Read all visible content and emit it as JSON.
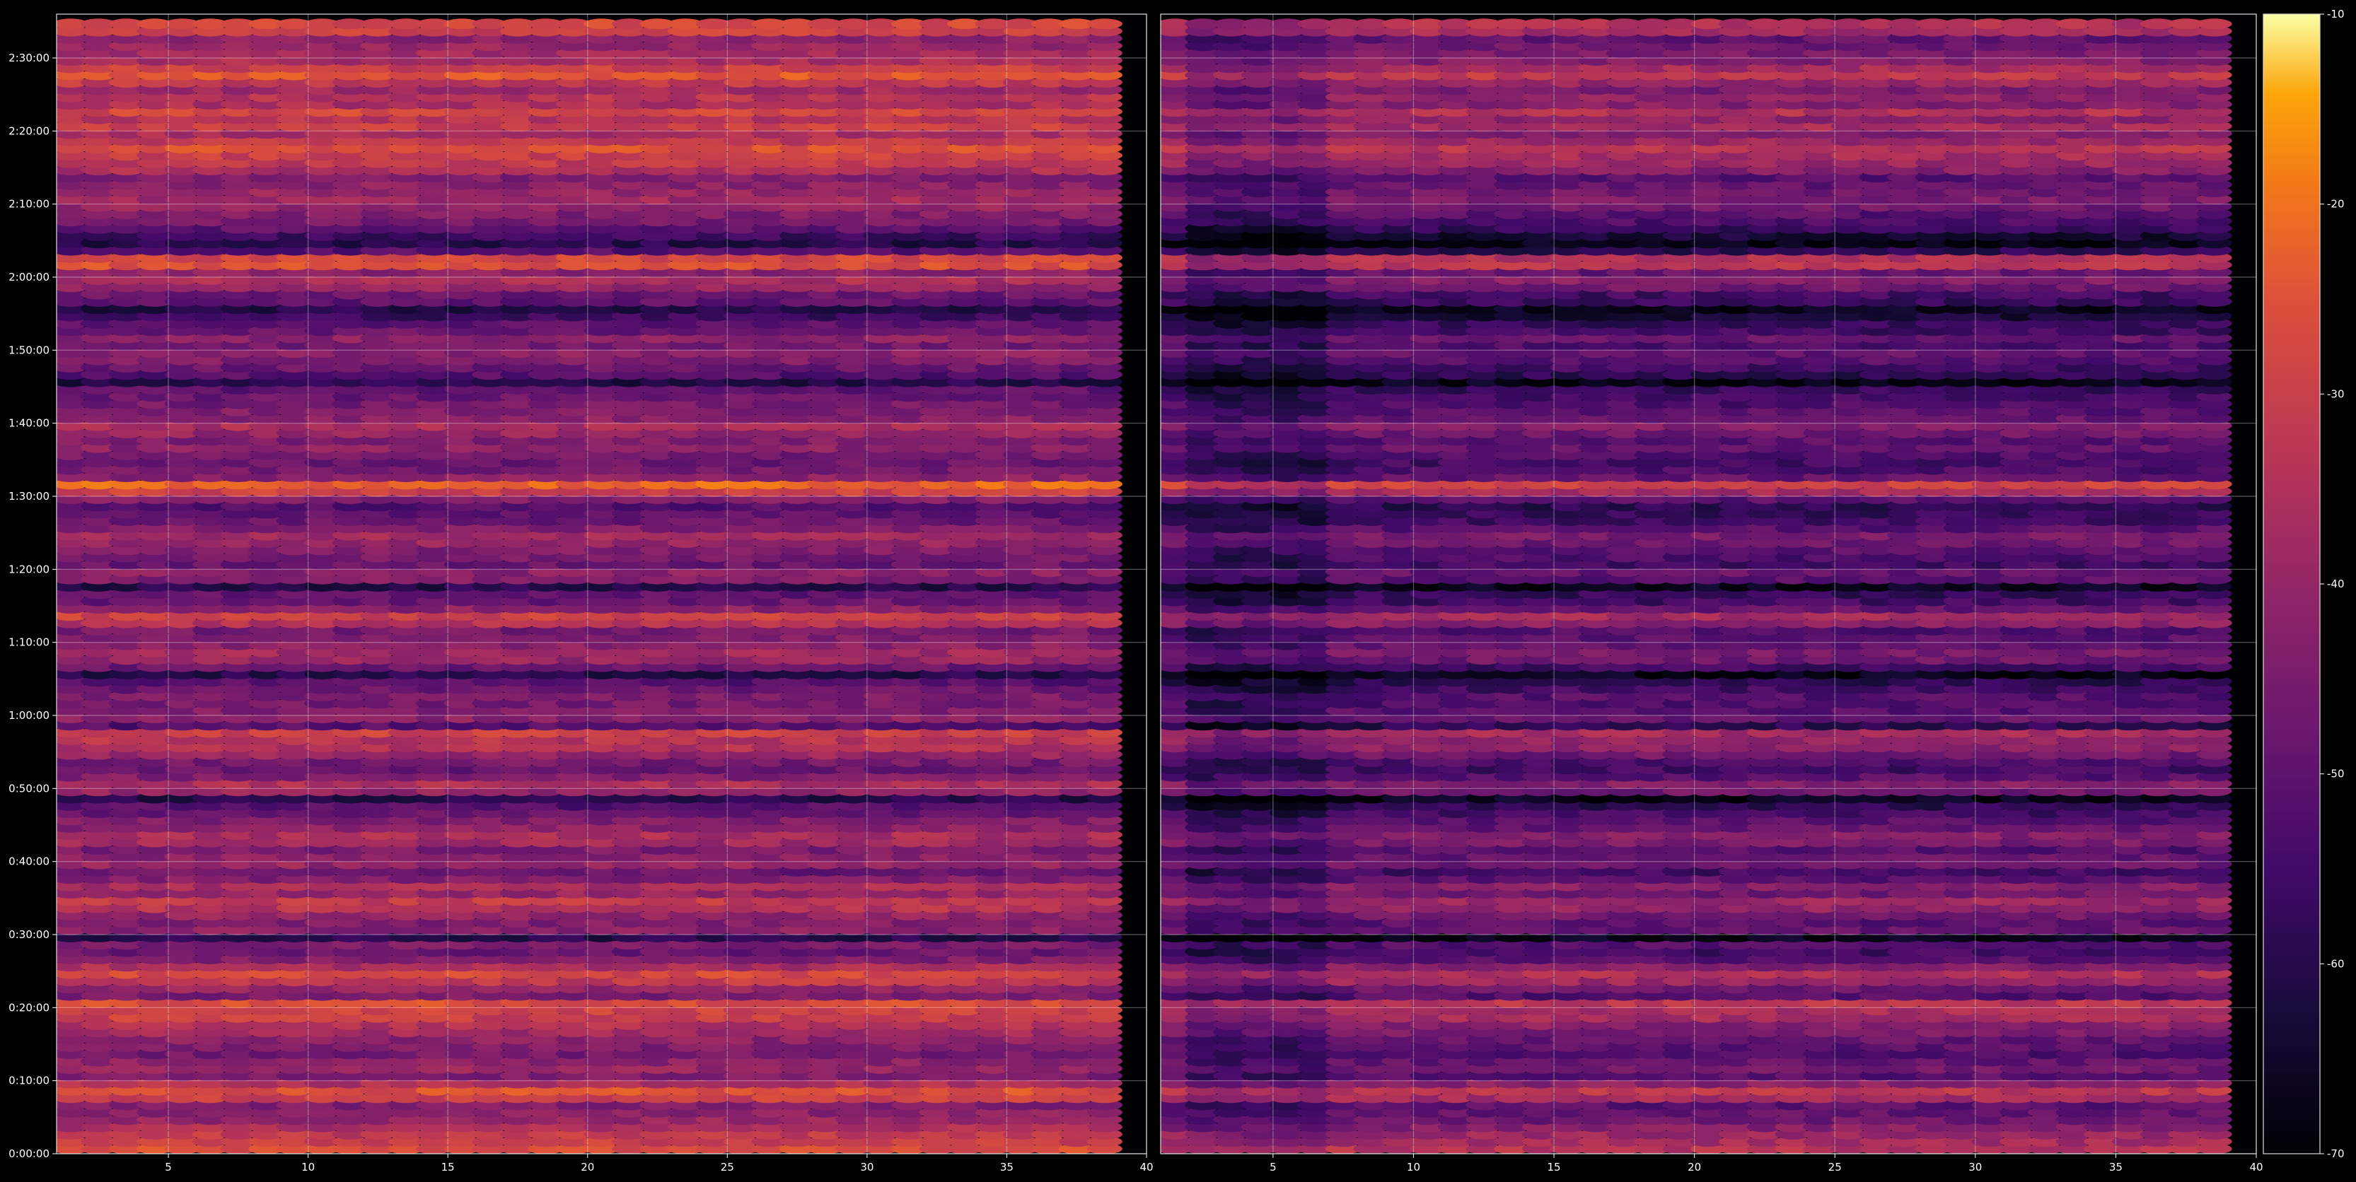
{
  "chart_data": {
    "type": "heatmap",
    "title": "",
    "xlabel": "",
    "ylabel": "",
    "panels": [
      {
        "name": "",
        "x_range": [
          1,
          40
        ],
        "x_ticks": [
          "5",
          "10",
          "15",
          "20",
          "25",
          "30",
          "35",
          "40"
        ]
      },
      {
        "name": "",
        "x_range": [
          1,
          40
        ],
        "x_ticks": [
          "5",
          "10",
          "15",
          "20",
          "25",
          "30",
          "35",
          "40"
        ]
      }
    ],
    "y_range_seconds": [
      0,
      9360
    ],
    "y_ticks": [
      "0:00:00",
      "0:10:00",
      "0:20:00",
      "0:30:00",
      "0:40:00",
      "0:50:00",
      "1:00:00",
      "1:10:00",
      "1:20:00",
      "1:30:00",
      "1:40:00",
      "1:50:00",
      "2:00:00",
      "2:10:00",
      "2:20:00",
      "2:30:00"
    ],
    "colorbar": {
      "range": [
        -70,
        -10
      ],
      "ticks": [
        "-70",
        "-60",
        "-50",
        "-40",
        "-30",
        "-20",
        "-10"
      ],
      "colormap": "inferno"
    },
    "band_profile": {
      "description_minutes": "row level in dB vs time in minutes (approximate)",
      "minutes": [
        1,
        2,
        3,
        4,
        5,
        6,
        7,
        8,
        9,
        10,
        11,
        12,
        13,
        14,
        15,
        16,
        17,
        18,
        19,
        20,
        21,
        22,
        23,
        24,
        25,
        26,
        27,
        28,
        29,
        30,
        31,
        32,
        33,
        34,
        35,
        36,
        37,
        38,
        39,
        40,
        41,
        42,
        43,
        44,
        45,
        46,
        47,
        48,
        49,
        50,
        51,
        52,
        53,
        54,
        55,
        56,
        57,
        58,
        59,
        60,
        61,
        62,
        63,
        64,
        65,
        66,
        67,
        68,
        69,
        70,
        71,
        72,
        73,
        74,
        75,
        76,
        77,
        78,
        79,
        80,
        81,
        82,
        83,
        84,
        85,
        86,
        87,
        88,
        89,
        90,
        91,
        92,
        93,
        94,
        95,
        96,
        97,
        98,
        99,
        100,
        101,
        102,
        103,
        104,
        105,
        106,
        107,
        108,
        109,
        110,
        111,
        112,
        113,
        114,
        115,
        116,
        117,
        118,
        119,
        120,
        121,
        122,
        123,
        124,
        125,
        126,
        127,
        128,
        129,
        130,
        131,
        132,
        133,
        134,
        135,
        136,
        137,
        138,
        139,
        140,
        141,
        142,
        143,
        144,
        145,
        146,
        147,
        148,
        149,
        150,
        151,
        152,
        153,
        154,
        155
      ],
      "left_db": [
        -27,
        -30,
        -32,
        -36,
        -40,
        -42,
        -44,
        -30,
        -26,
        -35,
        -44,
        -40,
        -42,
        -46,
        -44,
        -42,
        -38,
        -35,
        -30,
        -29,
        -26,
        -45,
        -40,
        -32,
        -28,
        -36,
        -44,
        -48,
        -45,
        -60,
        -42,
        -44,
        -40,
        -34,
        -32,
        -40,
        -36,
        -44,
        -48,
        -40,
        -42,
        -45,
        -38,
        -36,
        -42,
        -44,
        -48,
        -52,
        -60,
        -40,
        -36,
        -44,
        -48,
        -46,
        -40,
        -35,
        -34,
        -30,
        -52,
        -42,
        -44,
        -46,
        -45,
        -48,
        -52,
        -60,
        -48,
        -40,
        -38,
        -42,
        -44,
        -46,
        -35,
        -30,
        -42,
        -48,
        -50,
        -60,
        -44,
        -42,
        -48,
        -46,
        -44,
        -40,
        -38,
        -44,
        -48,
        -50,
        -52,
        -44,
        -30,
        -22,
        -42,
        -46,
        -48,
        -46,
        -42,
        -44,
        -40,
        -36,
        -42,
        -44,
        -46,
        -48,
        -50,
        -60,
        -52,
        -48,
        -44,
        -42,
        -46,
        -42,
        -48,
        -50,
        -56,
        -60,
        -50,
        -48,
        -40,
        -36,
        -42,
        -26,
        -28,
        -52,
        -60,
        -56,
        -50,
        -46,
        -44,
        -40,
        -38,
        -40,
        -42,
        -44,
        -36,
        -32,
        -30,
        -26,
        -32,
        -36,
        -30,
        -34,
        -28,
        -36,
        -34,
        -38,
        -32,
        -25,
        -30,
        -36,
        -38,
        -40,
        -42,
        -30,
        -28
      ],
      "right_offset_db": -7
    }
  }
}
